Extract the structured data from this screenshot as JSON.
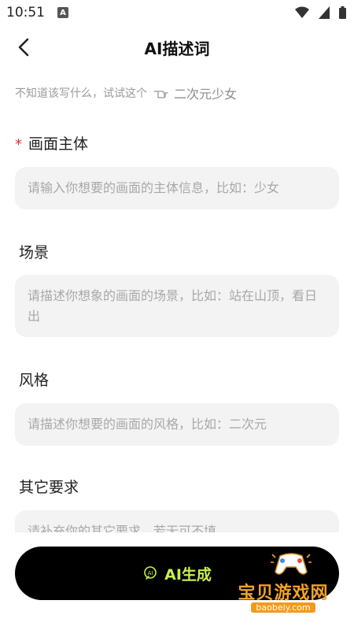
{
  "status_bar": {
    "time": "10:51",
    "notification_badge": "A"
  },
  "header": {
    "title": "AI描述词"
  },
  "hint": {
    "prompt": "不知道该写什么，试试这个",
    "example": "二次元少女"
  },
  "sections": {
    "subject": {
      "label": "画面主体",
      "required_mark": "*",
      "placeholder": "请输入你想要的画面的主体信息，比如：少女"
    },
    "scene": {
      "label": "场景",
      "placeholder": "请描述你想象的画面的场景，比如：站在山顶，看日出"
    },
    "style": {
      "label": "风格",
      "placeholder": "请描述你想要的画面的风格，比如：二次元"
    },
    "other": {
      "label": "其它要求",
      "placeholder": "请补充你的其它要求，若无可不填"
    }
  },
  "generate_button": {
    "label": "AI生成"
  },
  "watermark": {
    "text": "宝贝游戏网",
    "url": "baobeiy.com"
  },
  "colors": {
    "accent": "#c8f04a",
    "required": "#e03030",
    "field_bg": "#f3f3f3",
    "watermark": "#f3a224"
  }
}
